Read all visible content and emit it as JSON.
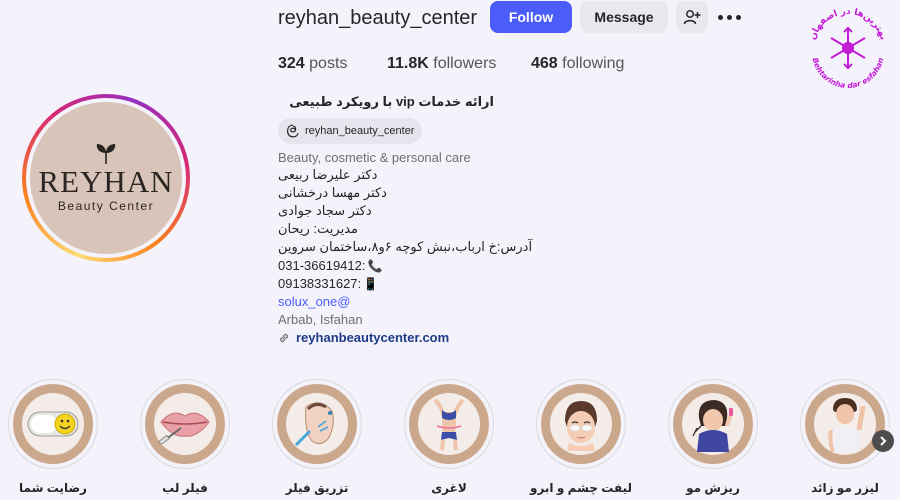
{
  "profile": {
    "username": "reyhan_beauty_center",
    "avatar": {
      "brand": "REYHAN",
      "sub": "Beauty Center"
    }
  },
  "actions": {
    "follow_label": "Follow",
    "message_label": "Message",
    "add_user_icon": "person-add-icon",
    "more_icon": "more-horizontal-icon"
  },
  "stats": {
    "posts_count": "324",
    "posts_label": "posts",
    "followers_count": "11.8K",
    "followers_label": "followers",
    "following_count": "468",
    "following_label": "following"
  },
  "bio": {
    "title": "ارائه خدمات vip با رویکرد طبیعی",
    "threads_handle": "reyhan_beauty_center",
    "category": "Beauty, cosmetic & personal care",
    "lines": [
      "دکتر علیرضا ربیعی",
      "دکتر مهسا درخشانی",
      "دکتر سجاد جوادی",
      "مدیریت: ریحان",
      "آدرس:خ ارباب،نبش کوچه ۶و۸،ساختمان سروین"
    ],
    "phone1": "031-36619412:",
    "phone1_emoji": "📞",
    "phone2": "09138331627:",
    "phone2_emoji": "📱",
    "mention": "solux_one@",
    "location": "Arbab, Isfahan",
    "website": "reyhanbeautycenter.com"
  },
  "watermark": {
    "top_text": "بهترین‌ها در اصفهان",
    "bottom_text": "Behtarinha dar esfahan"
  },
  "highlights": [
    {
      "label": "رضایت شما",
      "icon": "smiley-toggle-icon"
    },
    {
      "label": "فیلر لب",
      "icon": "lips-syringe-icon"
    },
    {
      "label": "تزریق فیلر",
      "icon": "face-injection-icon"
    },
    {
      "label": "لاغری",
      "icon": "slim-body-icon"
    },
    {
      "label": "لیفت چشم و ابرو",
      "icon": "eye-patch-face-icon"
    },
    {
      "label": "ریزش مو",
      "icon": "hair-loss-icon"
    },
    {
      "label": "لیزر مو زائد",
      "icon": "laser-hair-removal-icon"
    }
  ],
  "colors": {
    "accent": "#4a5df9",
    "background": "#f4f3fb",
    "highlight_ring": "#cba88c",
    "watermark": "#c41ad8"
  }
}
